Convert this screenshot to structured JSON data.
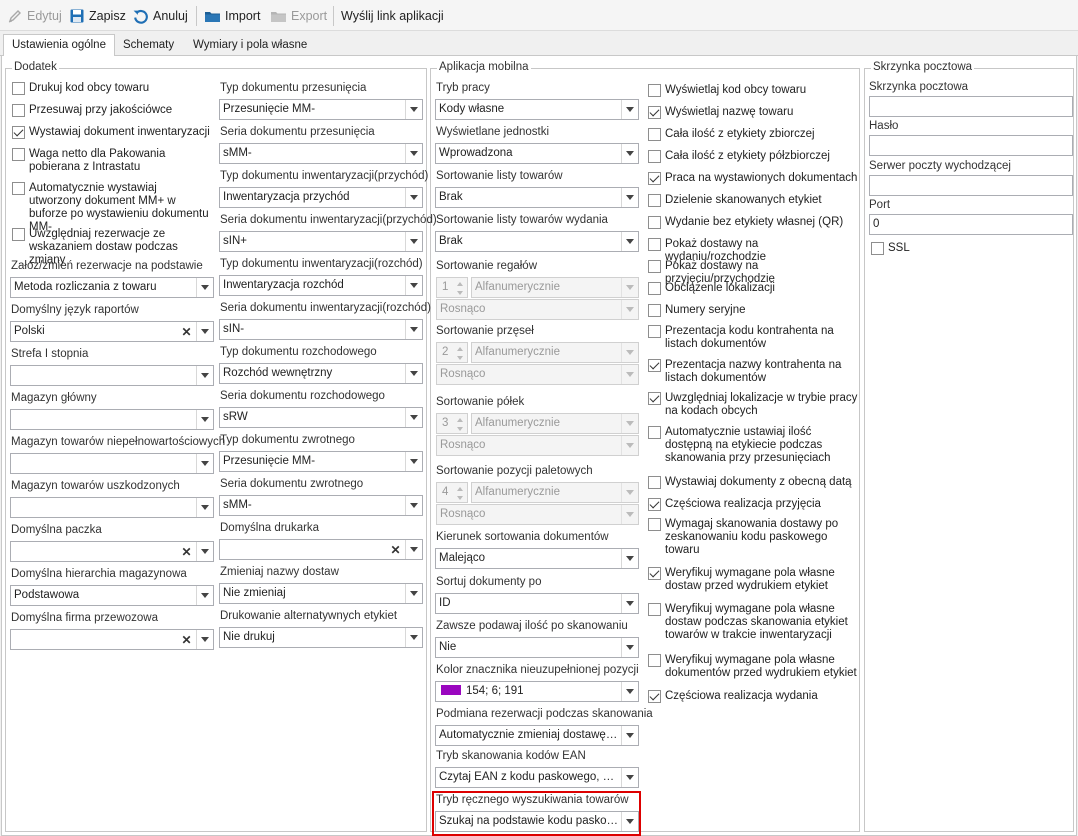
{
  "toolbar": {
    "edit": "Edytuj",
    "save": "Zapisz",
    "cancel": "Anuluj",
    "import": "Import",
    "export": "Export",
    "send_link": "Wyślij link aplikacji"
  },
  "tabs": [
    "Ustawienia ogólne",
    "Schematy",
    "Wymiary i pola własne"
  ],
  "dodatek": {
    "title": "Dodatek",
    "checkboxes": [
      {
        "label": "Drukuj kod obcy towaru",
        "checked": false
      },
      {
        "label": "Przesuwaj przy jakościówce",
        "checked": false
      },
      {
        "label": "Wystawiaj dokument inwentaryzacji",
        "checked": true
      },
      {
        "label": "Waga netto dla Pakowania pobierana z Intrastatu",
        "checked": false
      },
      {
        "label": "Automatycznie wystawiaj utworzony dokument MM+ w buforze po wystawieniu dokumentu MM-",
        "checked": false
      },
      {
        "label": "Uwzględniaj rezerwacje ze wskazaniem dostaw podczas zmiany",
        "checked": false
      }
    ],
    "left_fields": [
      {
        "label": "Załóż/zmień rezerwacje na podstawie",
        "value": "Metoda rozliczania z towaru",
        "clear": false
      },
      {
        "label": "Domyślny język raportów",
        "value": "Polski",
        "clear": true
      },
      {
        "label": "Strefa I stopnia",
        "value": "",
        "clear": false
      },
      {
        "label": "Magazyn główny",
        "value": "",
        "clear": false
      },
      {
        "label": "Magazyn towarów niepełnowartościowych",
        "value": "",
        "clear": false
      },
      {
        "label": "Magazyn towarów uszkodzonych",
        "value": "",
        "clear": false
      },
      {
        "label": "Domyślna paczka",
        "value": "",
        "clear": true
      },
      {
        "label": "Domyślna hierarchia magazynowa",
        "value": "Podstawowa",
        "clear": false
      },
      {
        "label": "Domyślna firma przewozowa",
        "value": "",
        "clear": true
      }
    ],
    "right_fields": [
      {
        "label": "Typ dokumentu przesunięcia",
        "value": "Przesunięcie MM-",
        "clear": false
      },
      {
        "label": "Seria dokumentu przesunięcia",
        "value": "sMM-",
        "clear": false
      },
      {
        "label": "Typ dokumentu inwentaryzacji(przychód)",
        "value": "Inwentaryzacja przychód",
        "clear": false
      },
      {
        "label": "Seria dokumentu inwentaryzacji(przychód)",
        "value": "sIN+",
        "clear": false
      },
      {
        "label": "Typ dokumentu inwentaryzacji(rozchód)",
        "value": "Inwentaryzacja rozchód",
        "clear": false
      },
      {
        "label": "Seria dokumentu inwentaryzacji(rozchód)",
        "value": "sIN-",
        "clear": false
      },
      {
        "label": "Typ dokumentu rozchodowego",
        "value": "Rozchód wewnętrzny",
        "clear": false
      },
      {
        "label": "Seria dokumentu rozchodowego",
        "value": "sRW",
        "clear": false
      },
      {
        "label": "Typ dokumentu zwrotnego",
        "value": "Przesunięcie MM-",
        "clear": false
      },
      {
        "label": "Seria dokumentu zwrotnego",
        "value": "sMM-",
        "clear": false
      },
      {
        "label": "Domyślna drukarka",
        "value": "",
        "clear": true
      },
      {
        "label": "Zmieniaj nazwy dostaw",
        "value": "Nie zmieniaj",
        "clear": false
      },
      {
        "label": "Drukowanie alternatywnych etykiet",
        "value": "Nie drukuj",
        "clear": false
      }
    ]
  },
  "mobile": {
    "title": "Aplikacja mobilna",
    "fields_top": [
      {
        "label": "Tryb pracy",
        "value": "Kody własne"
      },
      {
        "label": "Wyświetlane jednostki",
        "value": "Wprowadzona"
      },
      {
        "label": "Sortowanie listy towarów",
        "value": "Brak"
      },
      {
        "label": "Sortowanie listy towarów wydania",
        "value": "Brak"
      }
    ],
    "sort_groups": [
      {
        "label": "Sortowanie regałów",
        "num": "1",
        "mode": "Alfanumerycznie",
        "dir": "Rosnąco"
      },
      {
        "label": "Sortowanie przęseł",
        "num": "2",
        "mode": "Alfanumerycznie",
        "dir": "Rosnąco"
      },
      {
        "label": "Sortowanie półek",
        "num": "3",
        "mode": "Alfanumerycznie",
        "dir": "Rosnąco"
      },
      {
        "label": "Sortowanie pozycji paletowych",
        "num": "4",
        "mode": "Alfanumerycznie",
        "dir": "Rosnąco"
      }
    ],
    "fields_bottom": [
      {
        "label": "Kierunek sortowania dokumentów",
        "value": "Malejąco"
      },
      {
        "label": "Sortuj dokumenty po",
        "value": "ID"
      },
      {
        "label": "Zawsze podawaj ilość po skanowaniu",
        "value": "Nie"
      },
      {
        "label": "Kolor znacznika nieuzupełnionej pozycji",
        "value": "154; 6; 191",
        "color": "#9a06bf"
      },
      {
        "label": "Podmiana rezerwacji podczas skanowania",
        "value": "Automatycznie zmieniaj dostawę po..."
      },
      {
        "label": "Tryb skanowania kodów EAN",
        "value": "Czytaj EAN z kodu paskowego, kod..."
      },
      {
        "label": "Tryb ręcznego wyszukiwania towarów",
        "value": "Szukaj na podstawie kodu paskowe..."
      }
    ],
    "checkboxes": [
      {
        "label": "Wyświetlaj kod obcy towaru",
        "checked": false
      },
      {
        "label": "Wyświetlaj nazwę towaru",
        "checked": true
      },
      {
        "label": "Cała ilość z etykiety zbiorczej",
        "checked": false
      },
      {
        "label": "Cała ilość z etykiety półzbiorczej",
        "checked": false
      },
      {
        "label": "Praca na wystawionych dokumentach",
        "checked": true
      },
      {
        "label": "Dzielenie skanowanych etykiet",
        "checked": false
      },
      {
        "label": "Wydanie bez etykiety własnej (QR)",
        "checked": false
      },
      {
        "label": "Pokaż dostawy na wydaniu/rozchodzie",
        "checked": false
      },
      {
        "label": "Pokaż dostawy na przyjęciu/przychodzie",
        "checked": false
      },
      {
        "label": "Obciążenie lokalizacji",
        "checked": false
      },
      {
        "label": "Numery seryjne",
        "checked": false
      },
      {
        "label": "Prezentacja kodu kontrahenta na listach dokumentów",
        "checked": false
      },
      {
        "label": "Prezentacja nazwy kontrahenta na listach dokumentów",
        "checked": true
      },
      {
        "label": "Uwzględniaj lokalizacje w trybie pracy na kodach obcych",
        "checked": true
      },
      {
        "label": "Automatycznie ustawiaj ilość dostępną na etykiecie podczas skanowania przy przesunięciach",
        "checked": false
      },
      {
        "label": "Wystawiaj dokumenty z obecną datą",
        "checked": false
      },
      {
        "label": "Częściowa realizacja przyjęcia",
        "checked": true
      },
      {
        "label": "Wymagaj skanowania dostawy po zeskanowaniu kodu paskowego towaru",
        "checked": false
      },
      {
        "label": "Weryfikuj wymagane pola własne dostaw przed wydrukiem etykiet",
        "checked": true
      },
      {
        "label": "Weryfikuj wymagane pola własne dostaw podczas skanowania etykiet towarów w trakcie inwentaryzacji",
        "checked": false
      },
      {
        "label": "Weryfikuj wymagane pola własne dokumentów przed wydrukiem etykiet",
        "checked": false
      },
      {
        "label": "Częściowa realizacja wydania",
        "checked": true
      }
    ]
  },
  "mailbox": {
    "title": "Skrzynka pocztowa",
    "fields": [
      {
        "label": "Skrzynka pocztowa",
        "value": ""
      },
      {
        "label": "Hasło",
        "value": ""
      },
      {
        "label": "Serwer poczty wychodzącej",
        "value": ""
      },
      {
        "label": "Port",
        "value": "0"
      }
    ],
    "ssl_label": "SSL",
    "ssl_checked": false
  }
}
